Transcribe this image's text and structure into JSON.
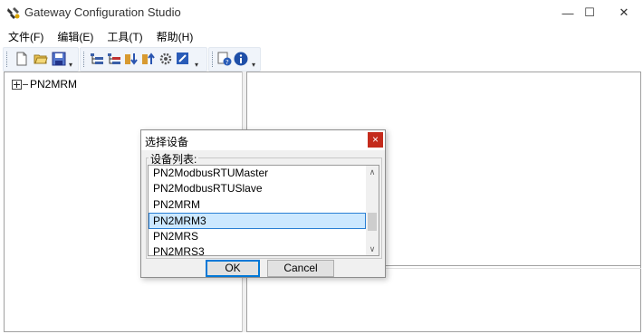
{
  "window": {
    "title": "Gateway Configuration Studio",
    "minimize_glyph": "—",
    "maximize_glyph": "☐",
    "close_glyph": "✕"
  },
  "menu": [
    {
      "label": "文件(F)"
    },
    {
      "label": "编辑(E)"
    },
    {
      "label": "工具(T)"
    },
    {
      "label": "帮助(H)"
    }
  ],
  "toolbar": {
    "icons": [
      "new-file-icon",
      "open-folder-icon",
      "save-icon",
      "tree-add-icon",
      "tree-remove-icon",
      "download-icon",
      "upload-icon",
      "settings-gear-icon",
      "edit-icon",
      "help-context-icon",
      "info-icon"
    ],
    "dropdown_glyph": "▾"
  },
  "tree": {
    "root": "PN2MRM"
  },
  "dialog": {
    "title": "选择设备",
    "close_glyph": "×",
    "group_label": "设备列表:",
    "devices": [
      "PN2ModbusRTUMaster",
      "PN2ModbusRTUSlave",
      "PN2MRM",
      "PN2MRM3",
      "PN2MRS",
      "PN2MRS3"
    ],
    "selected_device": "PN2MRM3",
    "scroll_up_glyph": "∧",
    "scroll_down_glyph": "∨",
    "ok_label": "OK",
    "cancel_label": "Cancel"
  },
  "colors": {
    "selection_bg": "#cce8ff",
    "selection_border": "#2a7fd4",
    "close_button": "#c42b1c"
  }
}
